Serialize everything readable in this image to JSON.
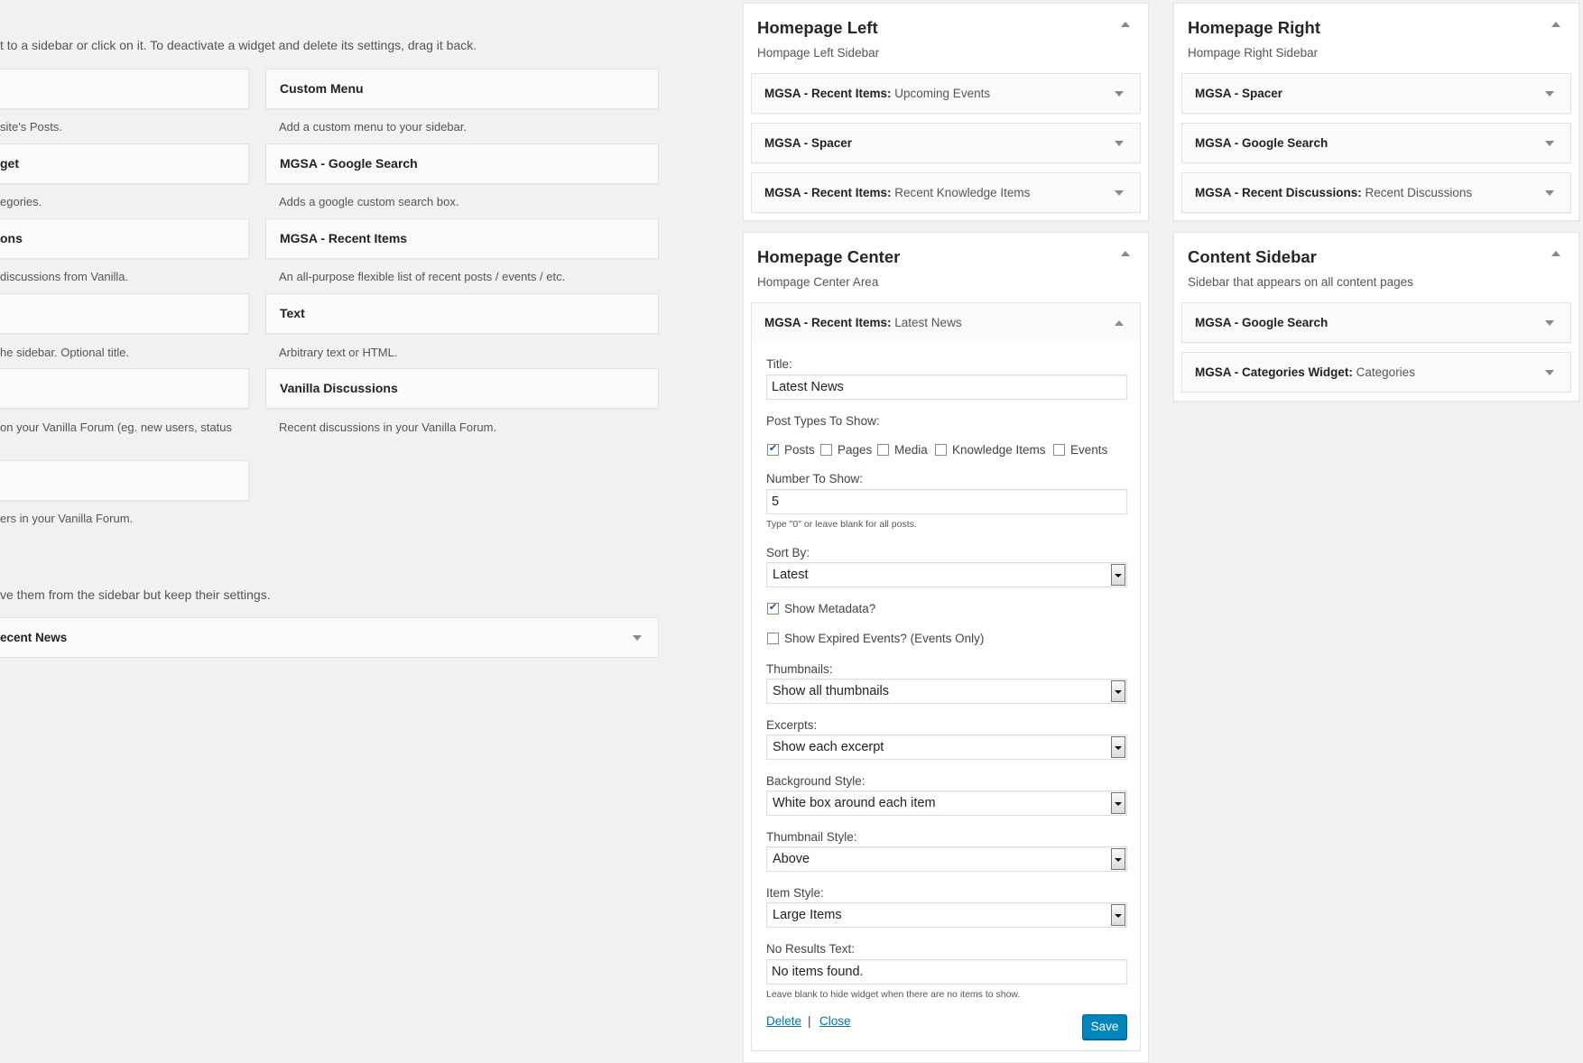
{
  "available": {
    "intro": "t to a sidebar or click on it. To deactivate a widget and delete its settings, drag it back.",
    "left_column": [
      {
        "title": "",
        "desc": "site's Posts."
      },
      {
        "title": "get",
        "desc": "egories."
      },
      {
        "title": "ons",
        "desc": "discussions from Vanilla."
      },
      {
        "title": "",
        "desc": "he sidebar. Optional title."
      },
      {
        "title": "",
        "desc": "on your Vanilla Forum (eg. new users, status"
      },
      {
        "title": "",
        "desc": "ers in your Vanilla Forum."
      }
    ],
    "right_column": [
      {
        "title": "Custom Menu",
        "desc": "Add a custom menu to your sidebar."
      },
      {
        "title": "MGSA - Google Search",
        "desc": "Adds a google custom search box."
      },
      {
        "title": "MGSA - Recent Items",
        "desc": "An all-purpose flexible list of recent posts / events / etc."
      },
      {
        "title": "Text",
        "desc": "Arbitrary text or HTML."
      },
      {
        "title": "Vanilla Discussions",
        "desc": "Recent discussions in your Vanilla Forum."
      }
    ]
  },
  "inactive": {
    "intro": "ve them from the sidebar but keep their settings.",
    "item": "ecent News"
  },
  "sidebars": {
    "homepage_left": {
      "title": "Homepage Left",
      "desc": "Hompage Left Sidebar",
      "widgets": [
        {
          "name": "MGSA - Recent Items",
          "sub": "Upcoming Events"
        },
        {
          "name": "MGSA - Spacer",
          "sub": ""
        },
        {
          "name": "MGSA - Recent Items",
          "sub": "Recent Knowledge Items"
        }
      ]
    },
    "homepage_right": {
      "title": "Homepage Right",
      "desc": "Hompage Right Sidebar",
      "widgets": [
        {
          "name": "MGSA - Spacer",
          "sub": ""
        },
        {
          "name": "MGSA - Google Search",
          "sub": ""
        },
        {
          "name": "MGSA - Recent Discussions",
          "sub": "Recent Discussions"
        }
      ]
    },
    "homepage_center": {
      "title": "Homepage Center",
      "desc": "Hompage Center Area",
      "open_widget": {
        "name": "MGSA - Recent Items",
        "sub": "Latest News"
      }
    },
    "content_sidebar": {
      "title": "Content Sidebar",
      "desc": "Sidebar that appears on all content pages",
      "widgets": [
        {
          "name": "MGSA - Google Search",
          "sub": ""
        },
        {
          "name": "MGSA - Categories Widget",
          "sub": "Categories"
        }
      ]
    }
  },
  "form": {
    "title_label": "Title:",
    "title_value": "Latest News",
    "post_types_label": "Post Types To Show:",
    "post_types": [
      {
        "label": "Posts",
        "checked": true
      },
      {
        "label": "Pages",
        "checked": false
      },
      {
        "label": "Media",
        "checked": false
      },
      {
        "label": "Knowledge Items",
        "checked": false
      },
      {
        "label": "Events",
        "checked": false
      }
    ],
    "number_label": "Number To Show:",
    "number_value": "5",
    "number_help": "Type \"0\" or leave blank for all posts.",
    "sort_label": "Sort By:",
    "sort_value": "Latest",
    "show_metadata_label": "Show Metadata?",
    "show_metadata_checked": true,
    "show_expired_label": "Show Expired Events? (Events Only)",
    "show_expired_checked": false,
    "thumbnails_label": "Thumbnails:",
    "thumbnails_value": "Show all thumbnails",
    "excerpts_label": "Excerpts:",
    "excerpts_value": "Show each excerpt",
    "background_label": "Background Style:",
    "background_value": "White box around each item",
    "thumb_style_label": "Thumbnail Style:",
    "thumb_style_value": "Above",
    "item_style_label": "Item Style:",
    "item_style_value": "Large Items",
    "no_results_label": "No Results Text:",
    "no_results_value": "No items found.",
    "no_results_help": "Leave blank to hide widget when there are no items to show.",
    "delete_label": "Delete",
    "separator": "|",
    "close_label": "Close",
    "save_label": "Save"
  }
}
